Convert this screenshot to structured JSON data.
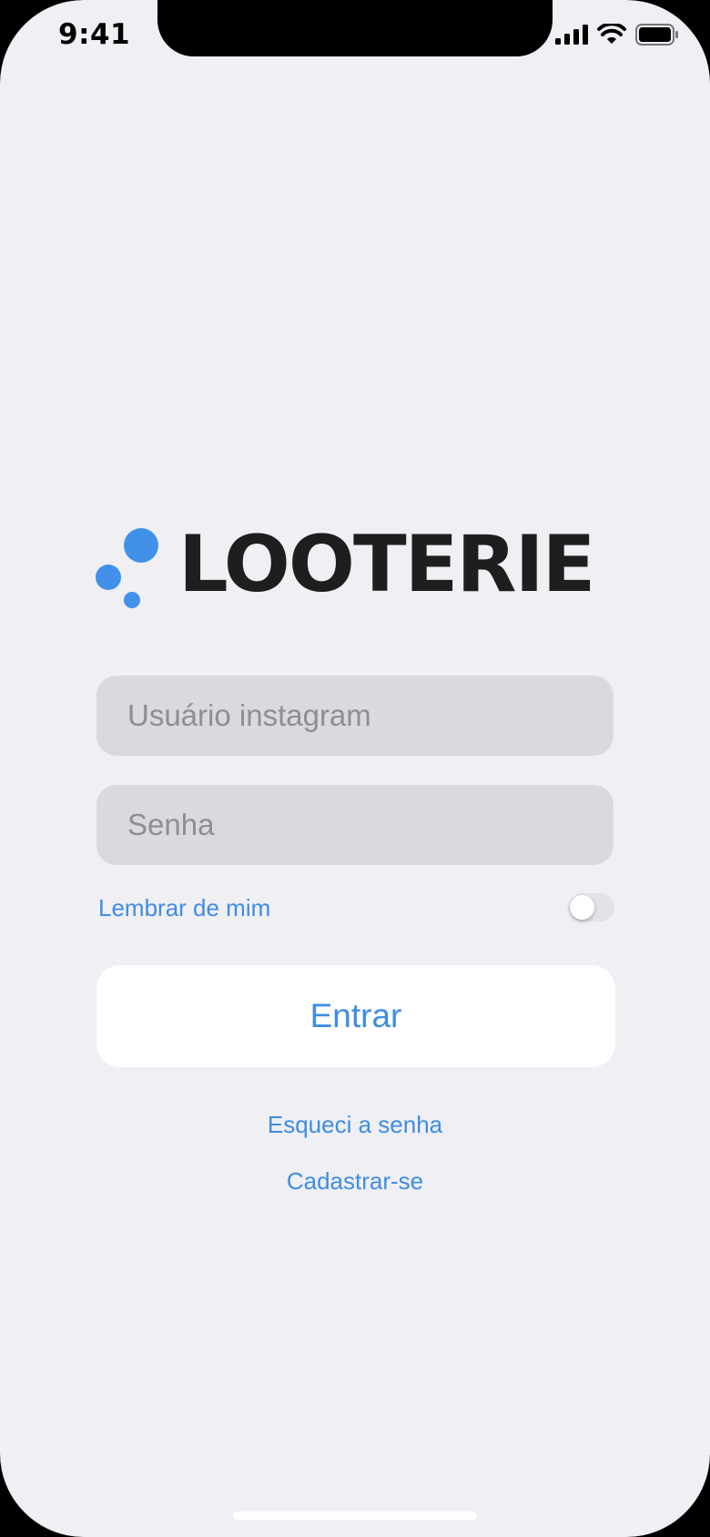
{
  "status_bar": {
    "time": "9:41",
    "icons": [
      "cellular-signal-icon",
      "wifi-icon",
      "battery-icon"
    ]
  },
  "logo": {
    "text": "LOOTERIE",
    "accent_color": "#4191ea"
  },
  "form": {
    "username_placeholder": "Usuário instagram",
    "password_placeholder": "Senha",
    "remember_label": "Lembrar de mim",
    "remember_on": false,
    "submit_label": "Entrar"
  },
  "links": {
    "forgot_password": "Esqueci a senha",
    "sign_up": "Cadastrar-se"
  },
  "colors": {
    "accent": "#3f8de3",
    "background": "#efeff4",
    "field_background": "#d9d9de"
  }
}
